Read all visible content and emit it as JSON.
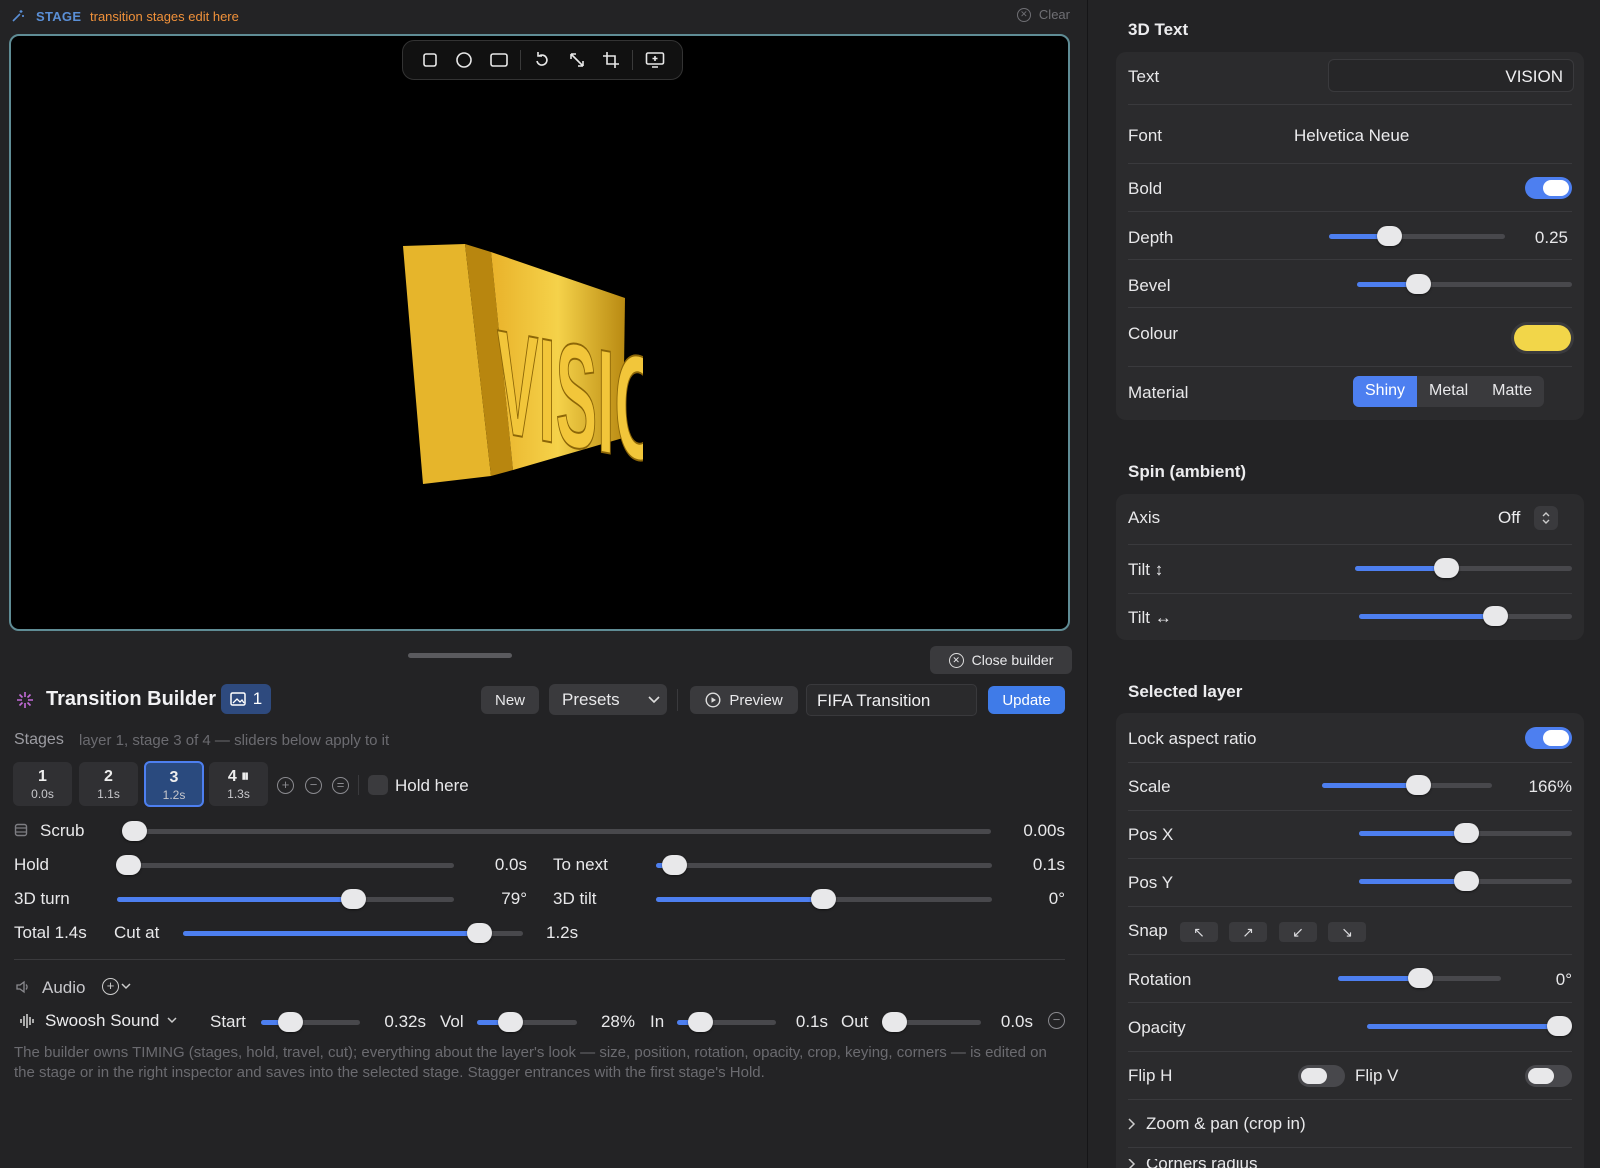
{
  "stage_bar": {
    "tag": "STAGE",
    "hint": "transition stages edit here",
    "clear_label": "Clear"
  },
  "canvas": {
    "text3d": "VISION",
    "colors": {
      "text": "#f0c030",
      "background": "#000000",
      "border": "#5f8c95"
    }
  },
  "toolbar": {
    "icons": [
      "square-icon",
      "circle-icon",
      "rounded-rect-icon",
      "rotate-icon",
      "resize-icon",
      "crop-icon",
      "screen-add-icon"
    ]
  },
  "close_builder_label": "Close builder",
  "builder": {
    "title": "Transition Builder",
    "layer_badge": "1",
    "new_label": "New",
    "presets_label": "Presets",
    "preview_label": "Preview",
    "name_value": "FIFA Transition",
    "update_label": "Update",
    "stages_label": "Stages",
    "stages_sub": "layer 1, stage 3 of 4 — sliders below apply to it",
    "stages": [
      {
        "n": "1",
        "t": "0.0s"
      },
      {
        "n": "2",
        "t": "1.1s"
      },
      {
        "n": "3",
        "t": "1.2s"
      },
      {
        "n": "4 ⏸",
        "t": "1.3s"
      }
    ],
    "selected_stage": "3",
    "hold_here_label": "Hold here",
    "scrub_label": "Scrub",
    "scrub_value": "0.00s",
    "hold_label": "Hold",
    "hold_value": "0.0s",
    "to_next_label": "To next",
    "to_next_value": "0.1s",
    "turn_label": "3D turn",
    "turn_value": "79°",
    "tilt_label": "3D tilt",
    "tilt_value": "0°",
    "total_label": "Total 1.4s",
    "cut_label": "Cut at",
    "cut_value": "1.2s",
    "audio_label": "Audio",
    "sound_name": "Swoosh Sound",
    "start_label": "Start",
    "start_value": "0.32s",
    "vol_label": "Vol",
    "vol_value": "28%",
    "in_label": "In",
    "in_value": "0.1s",
    "out_label": "Out",
    "out_value": "0.0s",
    "help": "The builder owns TIMING (stages, hold, travel, cut); everything about the layer's look — size, position, rotation, opacity, crop, keying, corners — is edited on the stage or in the right inspector and saves into the selected stage. Stagger entrances with the first stage's Hold."
  },
  "inspector": {
    "text3d_title": "3D Text",
    "text_label": "Text",
    "text_value": "VISION",
    "font_label": "Font",
    "font_value": "Helvetica Neue",
    "bold_label": "Bold",
    "depth_label": "Depth",
    "depth_value": "0.25",
    "bevel_label": "Bevel",
    "colour_label": "Colour",
    "colour_swatch": "#f2d649",
    "material_label": "Material",
    "materials": [
      "Shiny",
      "Metal",
      "Matte"
    ],
    "spin_title": "Spin (ambient)",
    "axis_label": "Axis",
    "axis_value": "Off",
    "tilt_v_label": "Tilt ↕",
    "tilt_h_label": "Tilt ↔",
    "layer_title": "Selected layer",
    "lock_label": "Lock aspect ratio",
    "scale_label": "Scale",
    "scale_value": "166%",
    "posx_label": "Pos X",
    "posy_label": "Pos Y",
    "snap_label": "Snap",
    "snap_icons": [
      "↖",
      "↗",
      "↙",
      "↘"
    ],
    "rotation_label": "Rotation",
    "rotation_value": "0°",
    "opacity_label": "Opacity",
    "fliph_label": "Flip H",
    "flipv_label": "Flip V",
    "zoom_label": "Zoom & pan (crop in)",
    "corners_label": "Corners radius"
  },
  "accent": "#4d7ff0"
}
